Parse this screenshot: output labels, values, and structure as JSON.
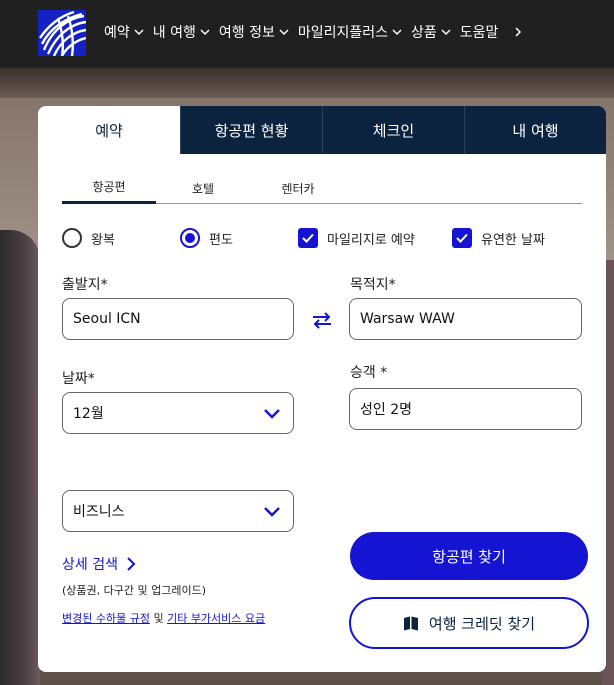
{
  "nav": {
    "items": [
      {
        "label": "예약"
      },
      {
        "label": "내 여행"
      },
      {
        "label": "여행 정보"
      },
      {
        "label": "마일리지플러스"
      },
      {
        "label": "상품"
      },
      {
        "label": "도움말"
      }
    ]
  },
  "card": {
    "tabs": [
      {
        "label": "예약"
      },
      {
        "label": "항공편 현황"
      },
      {
        "label": "체크인"
      },
      {
        "label": "내 여행"
      }
    ],
    "subtabs": [
      {
        "label": "항공편"
      },
      {
        "label": "호텔"
      },
      {
        "label": "렌터카"
      }
    ],
    "trip_type": {
      "round_trip": "왕복",
      "one_way": "편도",
      "selected": "편도"
    },
    "options": {
      "miles_label": "마일리지로 예약",
      "miles_checked": true,
      "flexible_label": "유연한 날짜",
      "flexible_checked": true
    },
    "origin": {
      "label": "출발지*",
      "value": "Seoul ICN"
    },
    "destination": {
      "label": "목적지*",
      "value": "Warsaw WAW"
    },
    "date": {
      "label": "날짜*",
      "value": "12월"
    },
    "passengers": {
      "label": "승객 *",
      "value": "성인 2명"
    },
    "cabin": {
      "value": "비즈니스"
    },
    "advanced": {
      "link": "상세 검색",
      "sub": "(상품권, 다구간 및 업그레이드)"
    },
    "policy": {
      "link1": "변경된 수하물 규정",
      "and": " 및 ",
      "link2": "기타 부가서비스 요금"
    },
    "find_flights": "항공편 찾기",
    "find_credits": "여행 크레딧 찾기"
  },
  "colors": {
    "brand_navy": "#0c2340",
    "accent_blue": "#1414d2",
    "nav_bg": "#202020"
  }
}
